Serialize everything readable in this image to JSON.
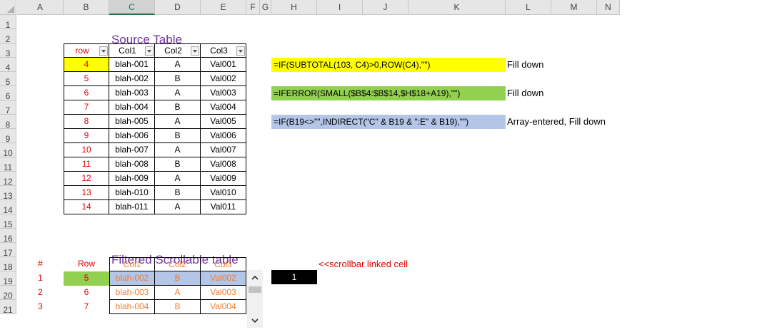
{
  "columns": [
    "A",
    "B",
    "C",
    "D",
    "E",
    "F",
    "G",
    "H",
    "I",
    "J",
    "K",
    "L",
    "M",
    "N"
  ],
  "selected_column": "C",
  "rows": [
    "1",
    "2",
    "3",
    "4",
    "5",
    "6",
    "7",
    "8",
    "9",
    "10",
    "11",
    "12",
    "13",
    "14",
    "15",
    "16",
    "17",
    "18",
    "19",
    "20",
    "21"
  ],
  "source_table": {
    "title": "Source Table",
    "headers": [
      "row",
      "Col1",
      "Col2",
      "Col3"
    ],
    "rows": [
      {
        "row": "4",
        "col1": "blah-001",
        "col2": "A",
        "col3": "Val001"
      },
      {
        "row": "5",
        "col1": "blah-002",
        "col2": "B",
        "col3": "Val002"
      },
      {
        "row": "6",
        "col1": "blah-003",
        "col2": "A",
        "col3": "Val003"
      },
      {
        "row": "7",
        "col1": "blah-004",
        "col2": "B",
        "col3": "Val004"
      },
      {
        "row": "8",
        "col1": "blah-005",
        "col2": "A",
        "col3": "Val005"
      },
      {
        "row": "9",
        "col1": "blah-006",
        "col2": "B",
        "col3": "Val006"
      },
      {
        "row": "10",
        "col1": "blah-007",
        "col2": "A",
        "col3": "Val007"
      },
      {
        "row": "11",
        "col1": "blah-008",
        "col2": "B",
        "col3": "Val008"
      },
      {
        "row": "12",
        "col1": "blah-009",
        "col2": "A",
        "col3": "Val009"
      },
      {
        "row": "13",
        "col1": "blah-010",
        "col2": "B",
        "col3": "Val010"
      },
      {
        "row": "14",
        "col1": "blah-011",
        "col2": "A",
        "col3": "Val011"
      }
    ]
  },
  "formulas": [
    {
      "text": "=IF(SUBTOTAL(103, C4)>0,ROW(C4),\"\")",
      "note": "Fill down",
      "color": "#ffff00"
    },
    {
      "text": "=IFERROR(SMALL($B$4:$B$14,$H$18+A19),\"\")",
      "note": "Fill down",
      "color": "#92d050"
    },
    {
      "text": "=IF(B19<>\"\",INDIRECT(\"C\" & B19  & \":E\" & B19),\"\")",
      "note": "Array-entered, Fill down",
      "color": "#b4c6e7"
    }
  ],
  "filtered_table": {
    "title": "Filtered Scrollable table",
    "headers": [
      "#",
      "Row",
      "Col1",
      "Col2",
      "Col3"
    ],
    "rows": [
      {
        "n": "1",
        "row": "5",
        "col1": "blah-002",
        "col2": "B",
        "col3": "Val002"
      },
      {
        "n": "2",
        "row": "6",
        "col1": "blah-003",
        "col2": "A",
        "col3": "Val003"
      },
      {
        "n": "3",
        "row": "7",
        "col1": "blah-004",
        "col2": "B",
        "col3": "Val004"
      }
    ]
  },
  "scrollbar": {
    "up_icon": "chevron-up-icon",
    "down_icon": "chevron-down-icon",
    "position": 0.0
  },
  "linked_cell": {
    "value": "1",
    "note": "<<scrollbar linked cell"
  },
  "colors": {
    "highlight_yellow": "#ffff00",
    "highlight_green": "#92d050",
    "highlight_blue": "#b4c6e7",
    "title_purple": "#7030a0",
    "red": "#e00000",
    "orange": "#ed7d31"
  }
}
